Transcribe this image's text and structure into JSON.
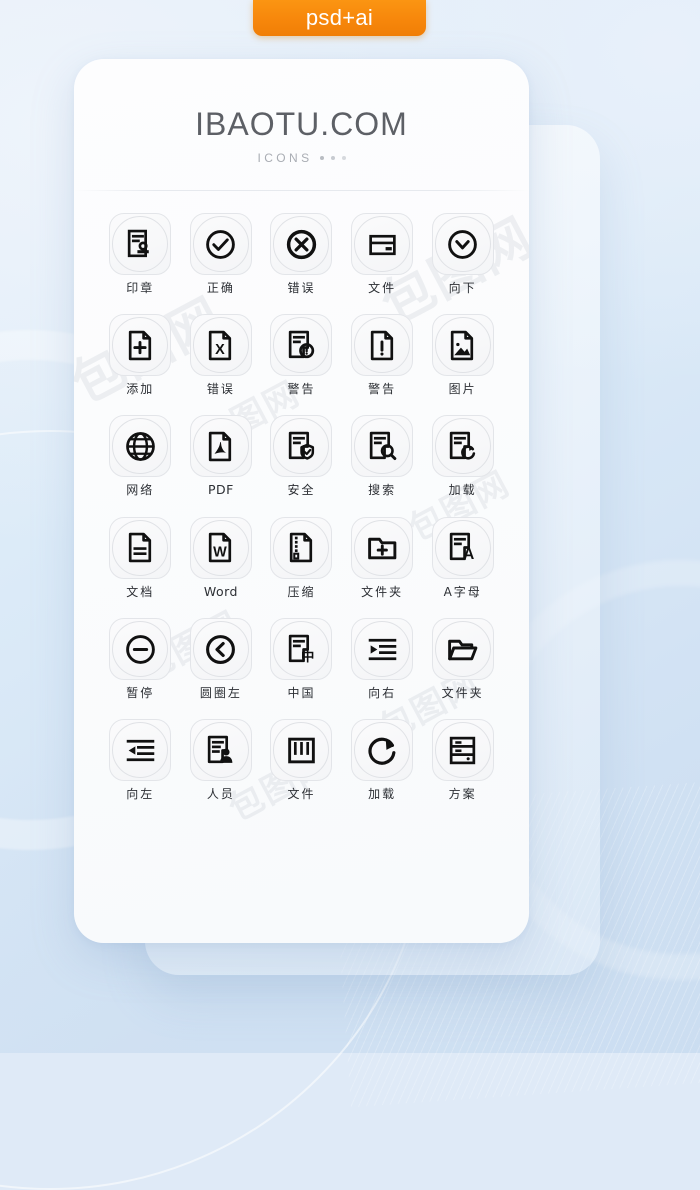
{
  "badge": {
    "label": "psd+ai",
    "color": "#f7870b"
  },
  "header": {
    "title": "IBAOTU.COM",
    "subtitle": "ICONS",
    "dot_count": 3
  },
  "watermarks": [
    {
      "text": "包图网"
    },
    {
      "text": "包图网"
    }
  ],
  "grid": {
    "columns": 5,
    "rows": 6,
    "icons": [
      {
        "label": "印章",
        "icon": "stamp-document-icon"
      },
      {
        "label": "正确",
        "icon": "check-circle-icon"
      },
      {
        "label": "错误",
        "icon": "x-circle-icon"
      },
      {
        "label": "文件",
        "icon": "card-file-icon"
      },
      {
        "label": "向下",
        "icon": "chevron-down-circle-icon"
      },
      {
        "label": "添加",
        "icon": "file-plus-icon"
      },
      {
        "label": "错误",
        "icon": "file-x-icon"
      },
      {
        "label": "警告",
        "icon": "document-alert-icon"
      },
      {
        "label": "警告",
        "icon": "file-exclamation-icon"
      },
      {
        "label": "图片",
        "icon": "file-image-icon"
      },
      {
        "label": "网络",
        "icon": "globe-icon"
      },
      {
        "label": "PDF",
        "icon": "file-pdf-icon"
      },
      {
        "label": "安全",
        "icon": "document-shield-icon"
      },
      {
        "label": "搜索",
        "icon": "document-search-icon"
      },
      {
        "label": "加载",
        "icon": "document-refresh-icon"
      },
      {
        "label": "文档",
        "icon": "file-text-icon"
      },
      {
        "label": "Word",
        "icon": "file-word-icon"
      },
      {
        "label": "压缩",
        "icon": "file-zip-icon"
      },
      {
        "label": "文件夹",
        "icon": "folder-plus-icon"
      },
      {
        "label": "A字母",
        "icon": "document-letter-a-icon"
      },
      {
        "label": "暂停",
        "icon": "minus-circle-icon"
      },
      {
        "label": "圆圈左",
        "icon": "chevron-left-circle-icon"
      },
      {
        "label": "中国",
        "icon": "document-china-icon"
      },
      {
        "label": "向右",
        "icon": "indent-right-icon"
      },
      {
        "label": "文件夹",
        "icon": "folder-open-icon"
      },
      {
        "label": "向左",
        "icon": "outdent-left-icon"
      },
      {
        "label": "人员",
        "icon": "document-person-icon"
      },
      {
        "label": "文件",
        "icon": "book-icon"
      },
      {
        "label": "加载",
        "icon": "refresh-cw-icon"
      },
      {
        "label": "方案",
        "icon": "server-rack-icon"
      }
    ]
  }
}
